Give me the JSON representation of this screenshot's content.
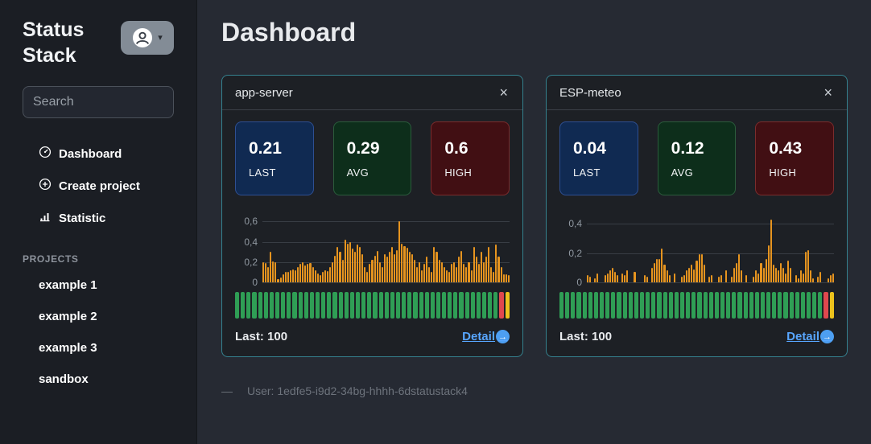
{
  "app": {
    "brand": "Status Stack"
  },
  "icons": {
    "caret_down": "▾",
    "close": "×",
    "arrow_right": "→"
  },
  "colors": {
    "accent_border": "#35818f",
    "bar_orange": "#e6941f",
    "link_blue": "#58a6ff",
    "status": {
      "up": "#2f9e55",
      "down": "#e0484e",
      "warn": "#ecc21c"
    }
  },
  "sidebar": {
    "search_placeholder": "Search",
    "nav": [
      {
        "label": "Dashboard"
      },
      {
        "label": "Create project"
      },
      {
        "label": "Statistic"
      }
    ],
    "projects_heading": "PROJECTS",
    "projects": [
      {
        "label": "example 1"
      },
      {
        "label": "example 2"
      },
      {
        "label": "example 3"
      },
      {
        "label": "sandbox"
      }
    ]
  },
  "main": {
    "title": "Dashboard",
    "footnote_dash": "—",
    "footnote_text": "User: 1edfe5-i9d2-34bg-hhhh-6dstatustack4"
  },
  "cards": [
    {
      "title": "app-server",
      "stats": [
        {
          "value": "0.21",
          "label": "LAST",
          "bg": "#102a52",
          "border": "#2e4f92"
        },
        {
          "value": "0.29",
          "label": "AVG",
          "bg": "#0d2e1b",
          "border": "#2b5c3c"
        },
        {
          "value": "0.6",
          "label": "HIGH",
          "bg": "#410f13",
          "border": "#7c2c2c"
        }
      ],
      "status_strip": {
        "segments": [
          {
            "status": "up",
            "count": 46
          },
          {
            "status": "down",
            "count": 1
          },
          {
            "status": "warn",
            "count": 1
          }
        ]
      },
      "last_label": "Last: 100",
      "detail_label": "Detail"
    },
    {
      "title": "ESP-meteo",
      "stats": [
        {
          "value": "0.04",
          "label": "LAST",
          "bg": "#102a52",
          "border": "#2e4f92"
        },
        {
          "value": "0.12",
          "label": "AVG",
          "bg": "#0d2e1b",
          "border": "#2b5c3c"
        },
        {
          "value": "0.43",
          "label": "HIGH",
          "bg": "#410f13",
          "border": "#7c2c2c"
        }
      ],
      "status_strip": {
        "segments": [
          {
            "status": "up",
            "count": 46
          },
          {
            "status": "down",
            "count": 1
          },
          {
            "status": "warn",
            "count": 1
          }
        ]
      },
      "last_label": "Last: 100",
      "detail_label": "Detail"
    }
  ],
  "chart_data": [
    {
      "type": "bar",
      "title": "app-server",
      "ylabel": "",
      "xlabel": "",
      "ylim": [
        0,
        0.65
      ],
      "grid": true,
      "bar_color": "#e6941f",
      "ticks": [
        {
          "value": 0,
          "label": "0"
        },
        {
          "value": 0.2,
          "label": "0,2"
        },
        {
          "value": 0.4,
          "label": "0,4"
        },
        {
          "value": 0.6,
          "label": "0,6"
        }
      ],
      "stats": {
        "last": 0.21,
        "avg": 0.29,
        "high": 0.6
      },
      "values": [
        0.2,
        0.19,
        0.15,
        0.3,
        0.21,
        0.2,
        0.03,
        0.05,
        0.08,
        0.1,
        0.1,
        0.12,
        0.13,
        0.12,
        0.15,
        0.18,
        0.2,
        0.17,
        0.18,
        0.19,
        0.15,
        0.12,
        0.09,
        0.07,
        0.1,
        0.12,
        0.11,
        0.15,
        0.2,
        0.26,
        0.35,
        0.3,
        0.22,
        0.42,
        0.38,
        0.4,
        0.33,
        0.3,
        0.37,
        0.35,
        0.28,
        0.15,
        0.1,
        0.18,
        0.22,
        0.26,
        0.31,
        0.2,
        0.15,
        0.28,
        0.25,
        0.3,
        0.35,
        0.28,
        0.32,
        0.6,
        0.38,
        0.36,
        0.34,
        0.3,
        0.28,
        0.22,
        0.15,
        0.2,
        0.12,
        0.18,
        0.25,
        0.15,
        0.1,
        0.35,
        0.3,
        0.22,
        0.2,
        0.15,
        0.12,
        0.1,
        0.18,
        0.2,
        0.15,
        0.25,
        0.31,
        0.18,
        0.15,
        0.2,
        0.12,
        0.35,
        0.25,
        0.18,
        0.3,
        0.2,
        0.25,
        0.35,
        0.15,
        0.1,
        0.37,
        0.25,
        0.15,
        0.08,
        0.08,
        0.07
      ]
    },
    {
      "type": "bar",
      "title": "ESP-meteo",
      "ylabel": "",
      "xlabel": "",
      "ylim": [
        0,
        0.45
      ],
      "grid": true,
      "bar_color": "#e6941f",
      "ticks": [
        {
          "value": 0,
          "label": "0"
        },
        {
          "value": 0.2,
          "label": "0,2"
        },
        {
          "value": 0.4,
          "label": "0,4"
        }
      ],
      "stats": {
        "last": 0.04,
        "avg": 0.12,
        "high": 0.43
      },
      "values": [
        0.05,
        0.04,
        0,
        0.03,
        0.06,
        0,
        0,
        0.05,
        0.06,
        0.08,
        0.1,
        0.07,
        0.05,
        0,
        0.06,
        0.05,
        0.08,
        0,
        0,
        0.07,
        0,
        0,
        0,
        0.05,
        0.04,
        0,
        0.1,
        0.13,
        0.16,
        0.16,
        0.23,
        0.12,
        0.08,
        0.05,
        0,
        0.06,
        0,
        0,
        0.04,
        0.05,
        0.08,
        0.1,
        0.12,
        0.09,
        0.15,
        0.19,
        0.19,
        0.12,
        0,
        0.04,
        0.05,
        0,
        0,
        0.04,
        0.05,
        0,
        0.08,
        0,
        0.04,
        0.1,
        0.13,
        0.19,
        0.08,
        0,
        0.05,
        0,
        0,
        0.04,
        0.08,
        0.06,
        0.13,
        0.1,
        0.16,
        0.25,
        0.43,
        0.12,
        0.1,
        0.08,
        0.13,
        0.1,
        0.06,
        0.15,
        0.1,
        0,
        0.05,
        0.03,
        0.08,
        0.06,
        0.21,
        0.22,
        0.08,
        0.03,
        0,
        0.04,
        0.07,
        0,
        0,
        0.03,
        0.05,
        0.06
      ]
    }
  ]
}
